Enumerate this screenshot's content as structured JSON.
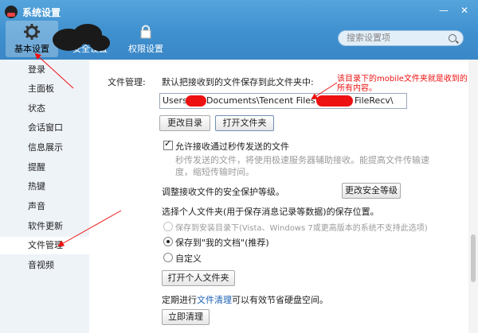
{
  "window": {
    "title": "系统设置",
    "minimize": "—",
    "close": "✕"
  },
  "tabs": [
    {
      "label": "基本设置",
      "icon": "gear-icon"
    },
    {
      "label": "安全设置",
      "icon": "shield-icon"
    },
    {
      "label": "权限设置",
      "icon": "lock-icon"
    }
  ],
  "search": {
    "placeholder": "搜索设置项"
  },
  "sidebar": {
    "items": [
      {
        "label": "登录"
      },
      {
        "label": "主面板"
      },
      {
        "label": "状态"
      },
      {
        "label": "会话窗口"
      },
      {
        "label": "信息展示"
      },
      {
        "label": "提醒"
      },
      {
        "label": "热键"
      },
      {
        "label": "声音"
      },
      {
        "label": "软件更新"
      },
      {
        "label": "文件管理"
      },
      {
        "label": "音视频"
      }
    ],
    "active": "文件管理"
  },
  "file_mgmt": {
    "section_label": "文件管理:",
    "default_save": "默认把接收到的文件保存到此文件夹中:",
    "path_start": "Users\\",
    "path_mid": "Documents\\Tencent Files\\",
    "path_end": "FileRecv\\",
    "change_dir": "更改目录",
    "open_folder": "打开文件夹",
    "allow_label": "允许接收通过秒传发送的文件",
    "allow_desc_1": "秒传发送的文件，将使用极速服务器辅助接收。能提高文件传输速",
    "allow_desc_2": "度，缩短传输时间。",
    "security_text": "调整接收文件的安全保护等级。",
    "security_btn": "更改安全等级",
    "personal_title": "选择个人文件夹(用于保存消息记录等数据)的保存位置。",
    "opt_install": "保存到安装目录下(Vista、Windows 7或更高版本的系统不支持此选项)",
    "opt_docs": "保存到\"我的文档\"(推荐)",
    "opt_custom": "自定义",
    "open_personal": "打开个人文件夹",
    "clean_pre": "定期进行",
    "clean_link": "文件清理",
    "clean_post": "可以有效节省硬盘空间。",
    "clean_btn": "立即清理"
  },
  "annotation": {
    "text": "该目录下的mobile文件夹就是收到的所有内容。"
  },
  "colors": {
    "header": "#3f90cf",
    "annotation": "#e11111",
    "link": "#1a5fb4",
    "sidebar": "#eef3f8"
  }
}
